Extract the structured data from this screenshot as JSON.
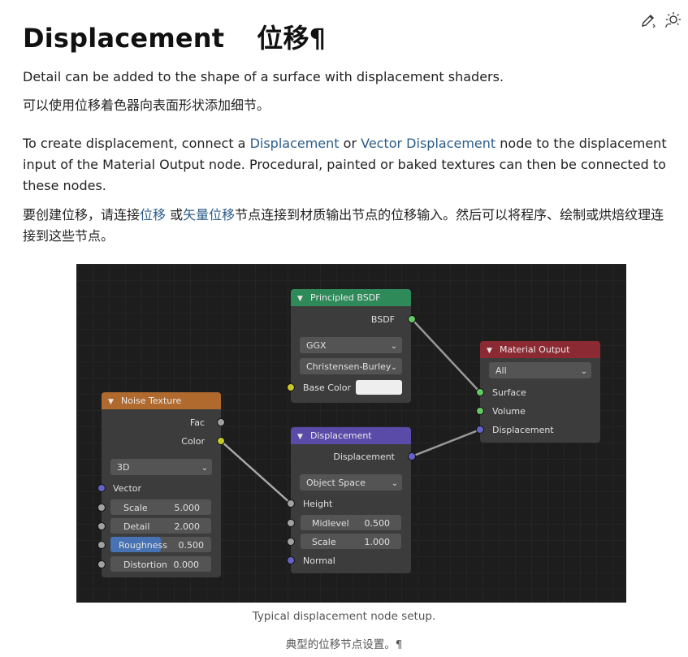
{
  "toolbar": {
    "edit_icon": "pencil-icon",
    "theme_icon": "sun-icon"
  },
  "page": {
    "title": "Displacement",
    "title_zh": "位移",
    "pilcrow": "¶",
    "p1": "Detail can be added to the shape of a surface with displacement shaders.",
    "p1_zh": "可以使用位移着色器向表面形状添加细节。",
    "p2_a": "To create displacement, connect a ",
    "p2_link1": "Displacement",
    "p2_b": " or ",
    "p2_link2": "Vector Displacement",
    "p2_c": " node to the displacement input of the Material Output node. Procedural, painted or baked textures can then be connected to these nodes.",
    "p2zh_a": "要创建位移，请连接",
    "p2zh_link1": "位移",
    "p2zh_b": " 或",
    "p2zh_link2": "矢量位移",
    "p2zh_c": "节点连接到材质输出节点的位移输入。然后可以将程序、绘制或烘焙纹理连接到这些节点。",
    "caption": "Typical displacement node setup.",
    "caption_zh": "典型的位移节点设置。",
    "caption_pilcrow": "¶"
  },
  "nodes": {
    "bsdf": {
      "title": "Principled BSDF",
      "output": "BSDF",
      "dist": "GGX",
      "sss": "Christensen-Burley",
      "base_color": "Base Color"
    },
    "mat": {
      "title": "Material Output",
      "target": "All",
      "surface": "Surface",
      "volume": "Volume",
      "displacement": "Displacement"
    },
    "noise": {
      "title": "Noise Texture",
      "fac": "Fac",
      "color": "Color",
      "dim": "3D",
      "vector": "Vector",
      "scale_l": "Scale",
      "scale_v": "5.000",
      "detail_l": "Detail",
      "detail_v": "2.000",
      "rough_l": "Roughness",
      "rough_v": "0.500",
      "rough_fill": 0.5,
      "dist_l": "Distortion",
      "dist_v": "0.000"
    },
    "disp": {
      "title": "Displacement",
      "output": "Displacement",
      "space": "Object Space",
      "height": "Height",
      "mid_l": "Midlevel",
      "mid_v": "0.500",
      "scale_l": "Scale",
      "scale_v": "1.000",
      "normal": "Normal"
    }
  },
  "colors": {
    "bg": "#222222",
    "node": "#3c3c3c",
    "field": "#545454",
    "green_header": "#2f8a5a",
    "red_header": "#8c2a33",
    "orange_header": "#b06a2e",
    "purple_header": "#5a4ba8",
    "socket_green": "#63c763",
    "socket_yellow": "#c7c729",
    "socket_blue": "#6363c7",
    "socket_gray": "#a1a1a1",
    "roughness_fill": "#4772b3"
  }
}
